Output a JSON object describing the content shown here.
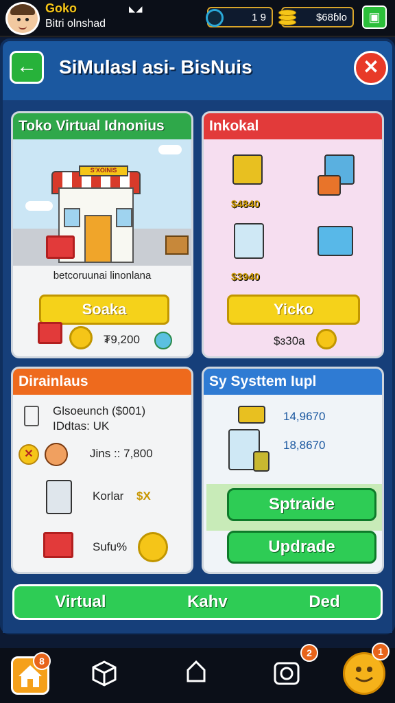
{
  "topbar": {
    "player_name": "Goko",
    "player_subtitle": "Bitri olnshad",
    "status_eyes": "◣◢",
    "gems_value": "1 9",
    "coins_value": "$68ɓlo"
  },
  "header": {
    "title": "SiMulasI asi- BisNuis",
    "back_icon": "←",
    "close_icon": "✕"
  },
  "panels": {
    "store": {
      "title": "Toko Virtual Idnonius",
      "sign_text": "S'XOINIS",
      "description": "betcoruunai linonlana",
      "button_label": "Soaka",
      "price": "₮9,200"
    },
    "inventory": {
      "title": "Inkokal",
      "price1": "$4840",
      "price2": "$3940",
      "button_label": "Yicko",
      "price": "$ɜ30a"
    },
    "stats": {
      "title": "Dirainlaus",
      "line1": "Glsoeunch ($001)",
      "line2": "IDdtas: UK",
      "line3": "Jins :: 7,800",
      "line4_label": "Korlar",
      "line4_value": "$X",
      "line5_label": "Sufu%",
      "x_mark": "✕"
    },
    "system": {
      "title": "Sy Systtem Iupl",
      "value1": "14,9670",
      "value2": "18,8670",
      "button1_label": "Sptraide",
      "button2_label": "Updrade"
    }
  },
  "bottom_tabs": [
    "Virtual",
    "Kahv",
    "Ded"
  ],
  "dock": {
    "home_badge": "8",
    "camera_badge": "2",
    "profile_badge": "1"
  },
  "colors": {
    "frame_blue": "#1a4e93",
    "green": "#2ecc55",
    "red": "#e23a3a",
    "orange": "#ee6a1d",
    "yellow": "#f5d21a"
  }
}
